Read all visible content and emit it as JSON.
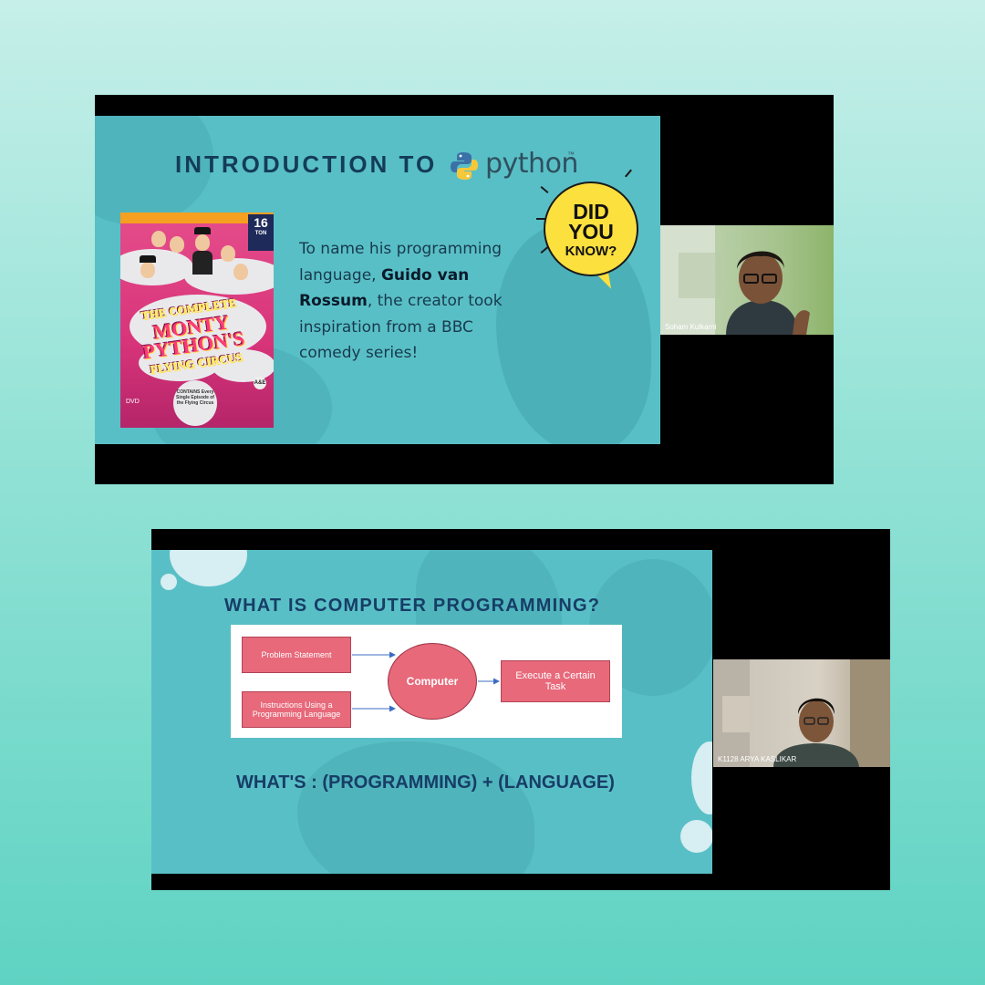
{
  "slide1": {
    "title": "INTRODUCTION TO",
    "logo_word": "python",
    "logo_tm": "™",
    "dvd": {
      "title_lines": [
        "THE COMPLETE",
        "MONTY",
        "PYTHON'S",
        "FLYING CIRCUS"
      ],
      "badge_number": "16",
      "badge_text": "TON",
      "contains_text": "CONTAINS Every Single Episode of the Flying Circus",
      "format_label": "DVD",
      "network_logo": "A&E"
    },
    "body_prefix": "To name his programming language,",
    "body_bold": "Guido van Rossum",
    "body_suffix": ", the creator took inspiration from a BBC comedy series!",
    "bubble": {
      "line1": "DID",
      "line2": "YOU",
      "line3": "KNOW?"
    }
  },
  "participant1": {
    "name": "Soham Kulkarni"
  },
  "slide2": {
    "title": "WHAT IS COMPUTER PROGRAMMING?",
    "diagram": {
      "input1": "Problem Statement",
      "input2": "Instructions Using a Programming Language",
      "center": "Computer",
      "output": "Execute a Certain Task"
    },
    "formula": "WHAT'S : (PROGRAMMING) +  (LANGUAGE)"
  },
  "participant2": {
    "name": "K1128 ARYA KASLIKAR"
  },
  "colors": {
    "background": "#93e2d6",
    "slide": "#59bfc6",
    "title_navy": "#143c5a",
    "bubble_yellow": "#fce03e",
    "diagram_pink": "#e7697a"
  }
}
